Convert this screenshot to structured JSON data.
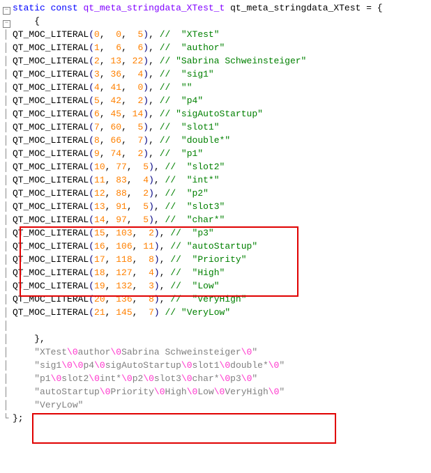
{
  "decl_line": {
    "kw_static": "static",
    "kw_const": "const",
    "type": "qt_meta_stringdata_XTest_t",
    "var": "qt_meta_stringdata_XTest",
    "tail": " = {"
  },
  "open_brace": "    {",
  "macro": "QT_MOC_LITERAL",
  "entries": [
    {
      "a": "0",
      "b": "0",
      "c": "5",
      "pad": " ",
      "label": "XTest"
    },
    {
      "a": "1",
      "b": "6",
      "c": "6",
      "pad": " ",
      "label": "author"
    },
    {
      "a": "2",
      "b": "13",
      "c": "22",
      "pad": "",
      "label": "Sabrina Schweinsteiger"
    },
    {
      "a": "3",
      "b": "36",
      "c": "4",
      "pad": " ",
      "label": "sig1"
    },
    {
      "a": "4",
      "b": "41",
      "c": "0",
      "pad": " ",
      "label": ""
    },
    {
      "a": "5",
      "b": "42",
      "c": "2",
      "pad": " ",
      "label": "p4"
    },
    {
      "a": "6",
      "b": "45",
      "c": "14",
      "pad": "",
      "label": "sigAutoStartup"
    },
    {
      "a": "7",
      "b": "60",
      "c": "5",
      "pad": " ",
      "label": "slot1"
    },
    {
      "a": "8",
      "b": "66",
      "c": "7",
      "pad": " ",
      "label": "double*"
    },
    {
      "a": "9",
      "b": "74",
      "c": "2",
      "pad": " ",
      "label": "p1"
    },
    {
      "a": "10",
      "b": "77",
      "c": "5",
      "pad": " ",
      "label": "slot2"
    },
    {
      "a": "11",
      "b": "83",
      "c": "4",
      "pad": " ",
      "label": "int*"
    },
    {
      "a": "12",
      "b": "88",
      "c": "2",
      "pad": " ",
      "label": "p2"
    },
    {
      "a": "13",
      "b": "91",
      "c": "5",
      "pad": " ",
      "label": "slot3"
    },
    {
      "a": "14",
      "b": "97",
      "c": "5",
      "pad": " ",
      "label": "char*"
    },
    {
      "a": "15",
      "b": "103",
      "c": "2",
      "pad": " ",
      "label": "p3"
    },
    {
      "a": "16",
      "b": "106",
      "c": "11",
      "pad": "",
      "label": "autoStartup"
    },
    {
      "a": "17",
      "b": "118",
      "c": "8",
      "pad": " ",
      "label": "Priority"
    },
    {
      "a": "18",
      "b": "127",
      "c": "4",
      "pad": " ",
      "label": "High"
    },
    {
      "a": "19",
      "b": "132",
      "c": "3",
      "pad": " ",
      "label": "Low"
    },
    {
      "a": "20",
      "b": "136",
      "c": "8",
      "pad": " ",
      "label": "VeryHigh"
    },
    {
      "a": "21",
      "b": "145",
      "c": "7",
      "pad": "",
      "label": "VeryLow",
      "nocomma": true
    }
  ],
  "close_inner": "    },",
  "strings": [
    [
      "XTest",
      "author",
      "Sabrina Schweinsteiger",
      ""
    ],
    [
      "sig1",
      "",
      "p4",
      "sigAutoStartup",
      "slot1",
      "double*",
      ""
    ],
    [
      "p1",
      "slot2",
      "int*",
      "p2",
      "slot3",
      "char*",
      "p3",
      ""
    ],
    [
      "autoStartup",
      "Priority",
      "High",
      "Low",
      "VeryHigh",
      ""
    ],
    [
      "VeryLow"
    ]
  ],
  "close_outer": "};"
}
